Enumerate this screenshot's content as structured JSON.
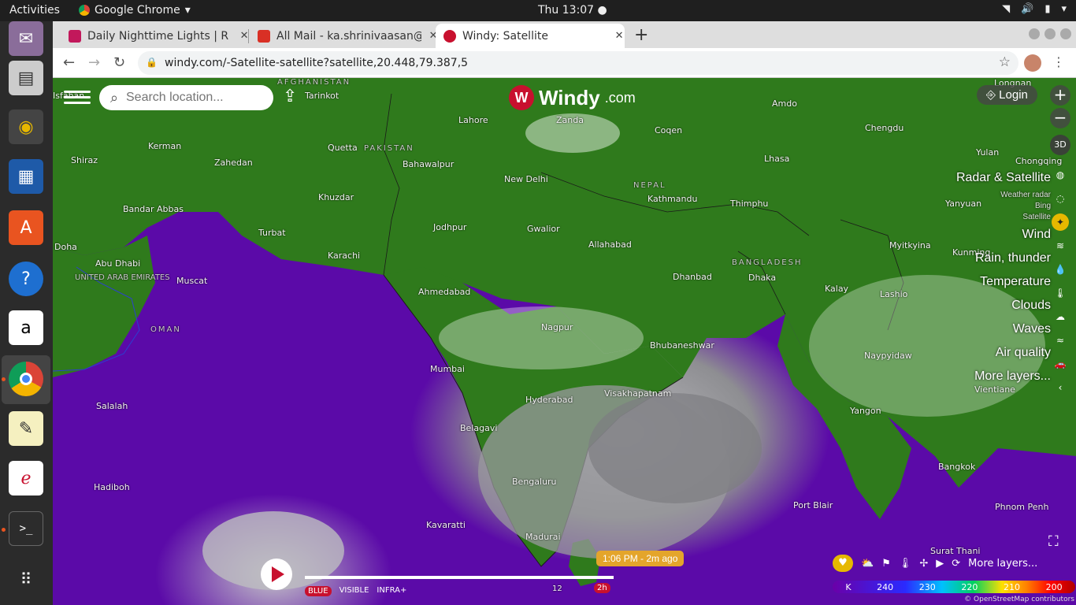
{
  "topbar": {
    "activities": "Activities",
    "app_name": "Google Chrome",
    "clock": "Thu 13:07"
  },
  "tabs": [
    {
      "title": "Daily Nighttime Lights | R",
      "favicon_color": "#c2185b"
    },
    {
      "title": "All Mail - ka.shrinivaasan@",
      "favicon_color": "#d93025"
    },
    {
      "title": "Windy: Satellite",
      "favicon_color": "#c8102e"
    }
  ],
  "address": {
    "url": "windy.com/-Satellite-satellite?satellite,20.448,79.387,5"
  },
  "map": {
    "search_placeholder": "Search location...",
    "share_place": "Tarinkot",
    "logo_text": "Windy",
    "logo_domain": ".com",
    "login": "Login",
    "three_d": "3D",
    "layers": [
      "Radar & Satellite",
      "Weather radar",
      "Bing",
      "Satellite",
      "Wind",
      "Rain, thunder",
      "Temperature",
      "Clouds",
      "Waves",
      "Air quality",
      "More layers..."
    ],
    "timestamp": "1:06 PM - 2m ago",
    "bands": [
      "BLUE",
      "VISIBLE",
      "INFRA+"
    ],
    "time_ticks": [
      "12",
      "2h"
    ],
    "more_layers_btn": "More layers...",
    "scale_unit": "K",
    "scale_values": [
      "240",
      "230",
      "220",
      "210",
      "200"
    ],
    "attribution": "© OpenStreetMap contributors",
    "labels": {
      "lahore": "Lahore",
      "new_delhi": "New Delhi",
      "jodhpur": "Jodhpur",
      "gwalior": "Gwalior",
      "allahabad": "Allahabad",
      "ahmedabad": "Ahmedabad",
      "mumbai": "Mumbai",
      "hyderabad": "Hyderabad",
      "nagpur": "Nagpur",
      "bengaluru": "Bengaluru",
      "kathmandu": "Kathmandu",
      "thimphu": "Thimphu",
      "lhasa": "Lhasa",
      "dhaka": "Dhaka",
      "yangon": "Yangon",
      "bangkok": "Bangkok",
      "muscat": "Muscat",
      "karachi": "Karachi",
      "quetta": "Quetta",
      "kerman": "Kerman",
      "shiraz": "Shiraz",
      "zahedan": "Zahedan",
      "bandar_abbas": "Bandar Abbas",
      "abu_dhabi": "Abu Dhabi",
      "salalah": "Salalah",
      "hadiboh": "Hadiboh",
      "bahawalpur": "Bahawalpur",
      "khuzdar": "Khuzdar",
      "turbat": "Turbat",
      "doha": "Doha",
      "belagavi": "Belagavi",
      "kavaratti": "Kavaratti",
      "madurai": "Madurai",
      "visakhapatnam": "Visakhapatnam",
      "bhubaneswar": "Bhubaneshwar",
      "dhanbad": "Dhanbad",
      "port_blair": "Port Blair",
      "myitkyina": "Myitkyina",
      "naypyidaw": "Naypyidaw",
      "kunming": "Kunming",
      "chengdu": "Chengdu",
      "amdo": "Amdo",
      "coqen": "Coqen",
      "zanda": "Zanda",
      "pakistan": "PAKISTAN",
      "afghanistan": "AFGHANISTAN",
      "oman": "OMAN",
      "uae": "UNITED ARAB EMIRATES",
      "bangladesh": "BANGLADESH",
      "nepal": "NEPAL",
      "kalay": "Kalay",
      "lashio": "Lashio",
      "vientiane": "Vientiane",
      "phnom_penh": "Phnom Penh",
      "surat_thani": "Surat Thani",
      "isfahan": "Isfahan",
      "longnan": "Longnan",
      "yulan": "Yulan",
      "chongqing": "Chongqing",
      "yanyuan": "Yanyuan"
    }
  }
}
